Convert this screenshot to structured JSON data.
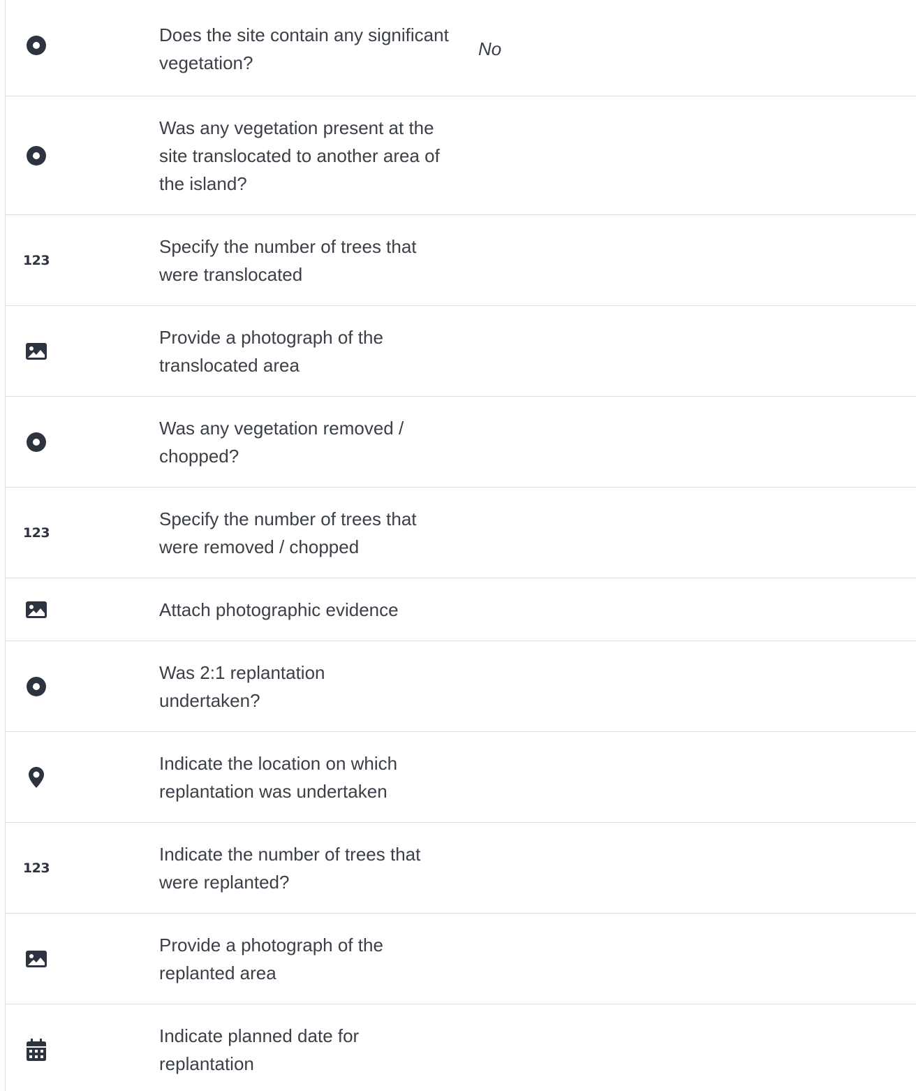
{
  "rows": [
    {
      "icon": "radio-icon",
      "question": "Does the site contain any significant vegetation?",
      "answer": "No"
    },
    {
      "icon": "radio-icon",
      "question": "Was any vegetation present at the site translocated to another area of the island?",
      "answer": ""
    },
    {
      "icon": "number-icon",
      "icon_text": "123",
      "question": "Specify the number of trees that were translocated",
      "answer": ""
    },
    {
      "icon": "image-icon",
      "question": "Provide a photograph of the translocated area",
      "answer": ""
    },
    {
      "icon": "radio-icon",
      "question": "Was any vegetation removed / chopped?",
      "answer": ""
    },
    {
      "icon": "number-icon",
      "icon_text": "123",
      "question": "Specify the number of trees that were removed / chopped",
      "answer": ""
    },
    {
      "icon": "image-icon",
      "question": "Attach photographic evidence",
      "answer": ""
    },
    {
      "icon": "radio-icon",
      "question": "Was 2:1 replantation undertaken?",
      "answer": ""
    },
    {
      "icon": "map-pin-icon",
      "question": "Indicate the location on which replantation was undertaken",
      "answer": ""
    },
    {
      "icon": "number-icon",
      "icon_text": "123",
      "question": "Indicate the number of trees that were replanted?",
      "answer": ""
    },
    {
      "icon": "image-icon",
      "question": "Provide a photograph of the replanted area",
      "answer": ""
    },
    {
      "icon": "calendar-icon",
      "question": "Indicate planned date for replantation",
      "answer": ""
    }
  ]
}
